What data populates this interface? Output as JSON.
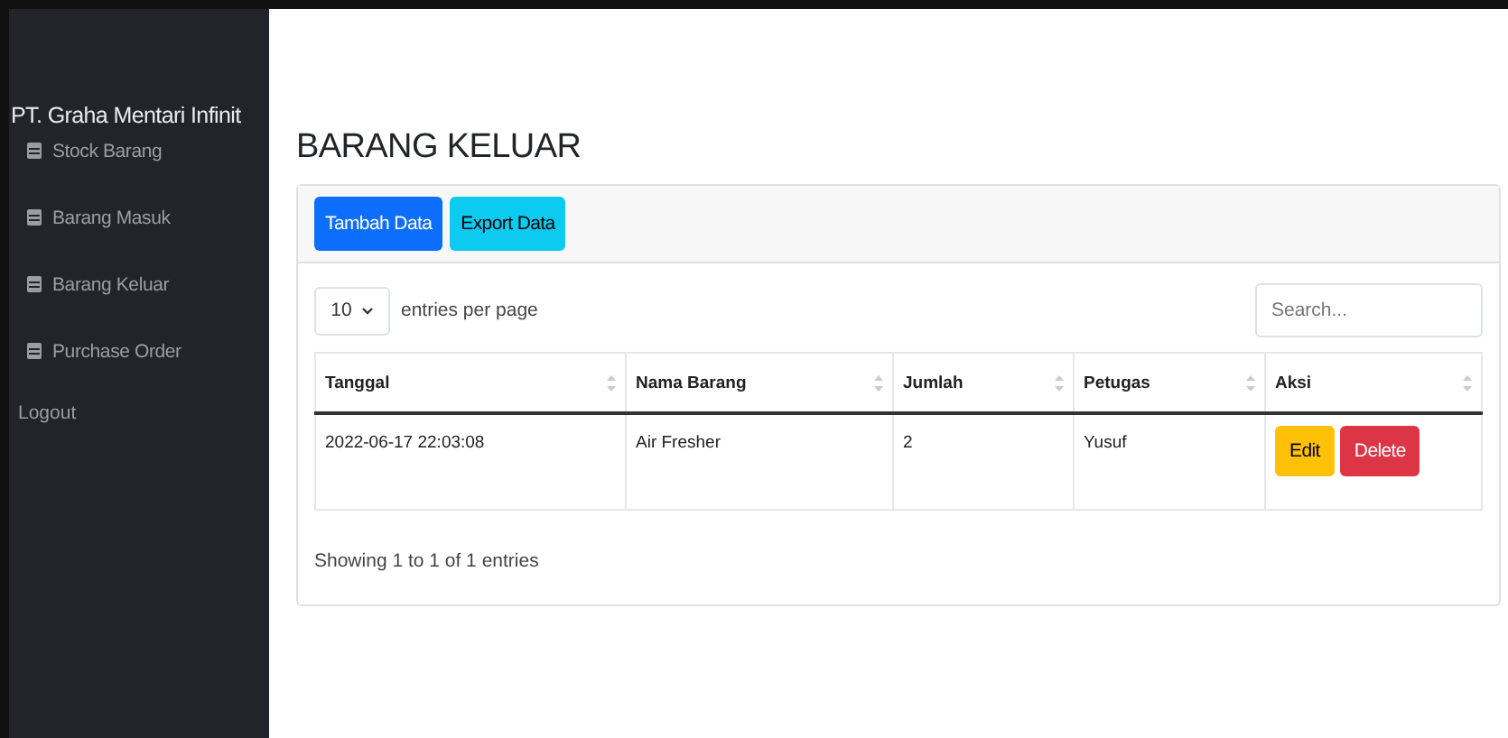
{
  "sidebar": {
    "brand": "PT. Graha Mentari Infinit",
    "items": [
      {
        "label": "Stock Barang"
      },
      {
        "label": "Barang Masuk"
      },
      {
        "label": "Barang Keluar"
      },
      {
        "label": "Purchase Order"
      }
    ],
    "logout": "Logout"
  },
  "page": {
    "title": "BARANG KELUAR"
  },
  "toolbar": {
    "buttons": [
      {
        "label": "Tambah Data",
        "kind": "primary"
      },
      {
        "label": "Export Data",
        "kind": "info"
      }
    ]
  },
  "table_controls": {
    "per_page": "10",
    "per_page_label": "entries per page",
    "search": {
      "placeholder": "Search..."
    }
  },
  "table": {
    "columns": [
      "Tanggal",
      "Nama Barang",
      "Jumlah",
      "Petugas",
      "Aksi"
    ],
    "rows": [
      {
        "cells": [
          "2022-06-17 22:03:08",
          "Air Fresher",
          "2",
          "Yusuf"
        ],
        "actions": [
          {
            "label": "Edit",
            "kind": "warning"
          },
          {
            "label": "Delete",
            "kind": "danger"
          }
        ]
      }
    ]
  },
  "footer": {
    "info": "Showing 1 to 1 of 1 entries"
  }
}
